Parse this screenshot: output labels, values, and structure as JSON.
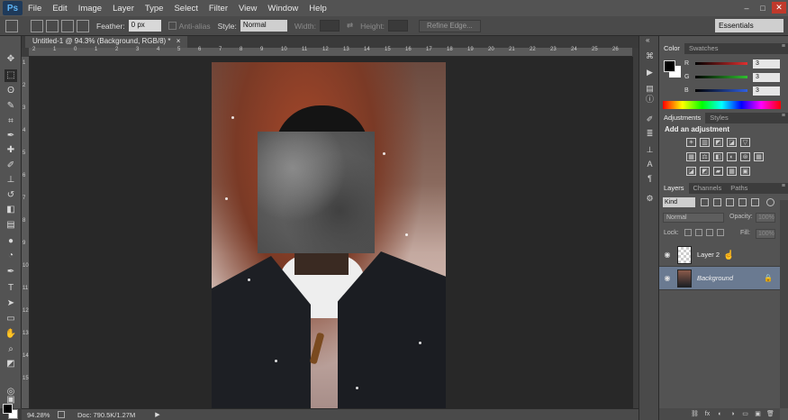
{
  "app": {
    "logo": "Ps",
    "menu": [
      "File",
      "Edit",
      "Image",
      "Layer",
      "Type",
      "Select",
      "Filter",
      "View",
      "Window",
      "Help"
    ],
    "window_controls": [
      "–",
      "□",
      "✕"
    ]
  },
  "options_bar": {
    "feather_label": "Feather:",
    "feather_value": "0 px",
    "antialias_label": "Anti-alias",
    "style_label": "Style:",
    "style_value": "Normal",
    "width_label": "Width:",
    "height_label": "Height:",
    "swap_icon": "⇄",
    "refine_edge_label": "Refine Edge...",
    "workspace_value": "Essentials"
  },
  "document": {
    "tab_title": "Untitled-1 @ 94.3% (Background, RGB/8) *",
    "tab_close": "×",
    "ruler_h_ticks": [
      "2",
      "1",
      "0",
      "1",
      "2",
      "3",
      "4",
      "5",
      "6",
      "7",
      "8",
      "9",
      "10",
      "11",
      "12",
      "13",
      "14",
      "15",
      "16",
      "17",
      "18",
      "19",
      "20",
      "21",
      "22",
      "23",
      "24",
      "25",
      "26"
    ],
    "ruler_v_ticks": [
      "1",
      "2",
      "3",
      "4",
      "5",
      "6",
      "7",
      "8",
      "9",
      "10",
      "11",
      "12",
      "13",
      "14",
      "15"
    ]
  },
  "statusbar": {
    "zoom": "94.28%",
    "doc_info": "Doc: 790.5K/1.27M",
    "arrow": "▶"
  },
  "tools": [
    {
      "name": "move-tool",
      "glyph": "✥"
    },
    {
      "name": "rectangular-marquee-tool",
      "glyph": "⬚"
    },
    {
      "name": "lasso-tool",
      "glyph": "ʘ"
    },
    {
      "name": "quick-selection-tool",
      "glyph": "✎"
    },
    {
      "name": "crop-tool",
      "glyph": "⌗"
    },
    {
      "name": "eyedropper-tool",
      "glyph": "✒"
    },
    {
      "name": "spot-healing-brush-tool",
      "glyph": "✚"
    },
    {
      "name": "brush-tool",
      "glyph": "✐"
    },
    {
      "name": "clone-stamp-tool",
      "glyph": "⊥"
    },
    {
      "name": "history-brush-tool",
      "glyph": "↺"
    },
    {
      "name": "eraser-tool",
      "glyph": "◧"
    },
    {
      "name": "gradient-tool",
      "glyph": "▤"
    },
    {
      "name": "blur-tool",
      "glyph": "●"
    },
    {
      "name": "dodge-tool",
      "glyph": "◔"
    },
    {
      "name": "pen-tool",
      "glyph": "✒"
    },
    {
      "name": "type-tool",
      "glyph": "T"
    },
    {
      "name": "path-selection-tool",
      "glyph": "➤"
    },
    {
      "name": "rectangle-tool",
      "glyph": "▭"
    },
    {
      "name": "hand-tool",
      "glyph": "✋"
    },
    {
      "name": "zoom-tool",
      "glyph": "⌕"
    },
    {
      "name": "default-colors",
      "glyph": "◩"
    },
    {
      "name": "quick-mask",
      "glyph": "◎"
    },
    {
      "name": "screen-mode",
      "glyph": "▣"
    }
  ],
  "dock_icons": [
    {
      "name": "history-icon",
      "glyph": "⌘"
    },
    {
      "name": "actions-icon",
      "glyph": "▶"
    },
    {
      "name": "properties-icon",
      "glyph": "▤"
    },
    {
      "name": "info-icon",
      "glyph": "ⓘ"
    },
    {
      "name": "brush-preset-icon",
      "glyph": "✐"
    },
    {
      "name": "brushes-icon",
      "glyph": "≣"
    },
    {
      "name": "clone-source-icon",
      "glyph": "⊥"
    },
    {
      "name": "character-icon",
      "glyph": "A"
    },
    {
      "name": "paragraph-icon",
      "glyph": "¶"
    },
    {
      "name": "tool-presets-icon",
      "glyph": "⚙"
    }
  ],
  "color_panel": {
    "tabs": [
      "Color",
      "Swatches"
    ],
    "channels": [
      {
        "label": "R",
        "value": "3",
        "color": "#e03030"
      },
      {
        "label": "G",
        "value": "3",
        "color": "#30c030"
      },
      {
        "label": "B",
        "value": "3",
        "color": "#3060e0"
      }
    ]
  },
  "adjustments_panel": {
    "tabs": [
      "Adjustments",
      "Styles"
    ],
    "title": "Add an adjustment",
    "rows": [
      [
        "☀",
        "▥",
        "◩",
        "◪",
        "▽"
      ],
      [
        "▦",
        "⚖",
        "◧",
        "◐",
        "⊛",
        "▦"
      ],
      [
        "◪",
        "◩",
        "▰",
        "▦",
        "▣"
      ]
    ]
  },
  "layers_panel": {
    "tabs": [
      "Layers",
      "Channels",
      "Paths"
    ],
    "filter_value": "Kind",
    "blend_mode": "Normal",
    "opacity_label": "Opacity:",
    "opacity_value": "100%",
    "lock_label": "Lock:",
    "fill_label": "Fill:",
    "fill_value": "100%",
    "layers": [
      {
        "name": "Layer 2",
        "visible_icon": "◉"
      },
      {
        "name": "Background",
        "visible_icon": "◉",
        "lock_icon": "🔒"
      }
    ],
    "bottom_icons": [
      "⛓",
      "fx",
      "◐",
      "◑",
      "▭",
      "▣",
      "🗑"
    ]
  },
  "panel_menu_icon": "≡",
  "collapse_icon": "«"
}
